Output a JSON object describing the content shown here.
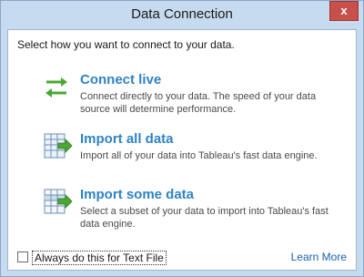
{
  "window": {
    "title": "Data Connection",
    "close_label": "x"
  },
  "prompt": "Select how you want to connect to your data.",
  "options": [
    {
      "title": "Connect live",
      "description": "Connect directly to your data. The speed of your data source will determine performance.",
      "icon": "two-way-arrows-icon"
    },
    {
      "title": "Import all data",
      "description": "Import all of your data into Tableau's fast data engine.",
      "icon": "import-table-icon"
    },
    {
      "title": "Import some data",
      "description": "Select a subset of your data to import into Tableau's fast data engine.",
      "icon": "import-partial-table-icon"
    }
  ],
  "footer": {
    "checkbox_label": "Always do this for Text File",
    "checkbox_checked": false,
    "learn_more": "Learn More"
  },
  "colors": {
    "accent": "#2e83c4",
    "close_button": "#c7504b",
    "frame": "#c6dbef",
    "arrow_green": "#4aa832"
  }
}
